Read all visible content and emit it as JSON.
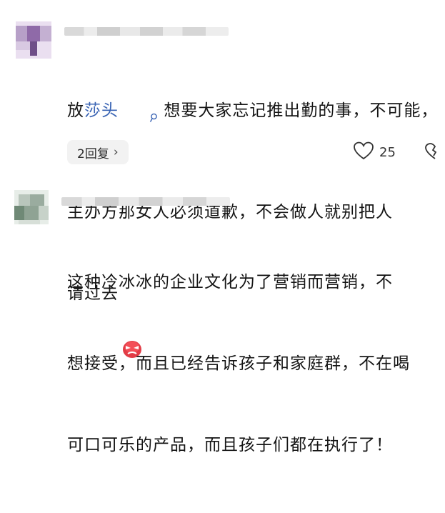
{
  "comments": [
    {
      "username": "",
      "text_prefix": "放",
      "mention": "莎头",
      "search_icon": "search-icon",
      "line1_rest": " 想要大家忘记推出勤的事，不可能，",
      "line2": "主办方那女人必须道歉，不会做人就别把人",
      "line3": "请过去",
      "emoji": "angry-face-emoji",
      "reply_label": "2回复",
      "reply_chevron": "›",
      "like_count": "25",
      "accent": "#3a64b4"
    },
    {
      "username": "",
      "line1": "这种冷冰冰的企业文化为了营销而营销，不",
      "line2": "想接受，而且已经告诉孩子和家庭群，不在喝",
      "line3": "可口可乐的产品，而且孩子们都在执行了！"
    }
  ]
}
